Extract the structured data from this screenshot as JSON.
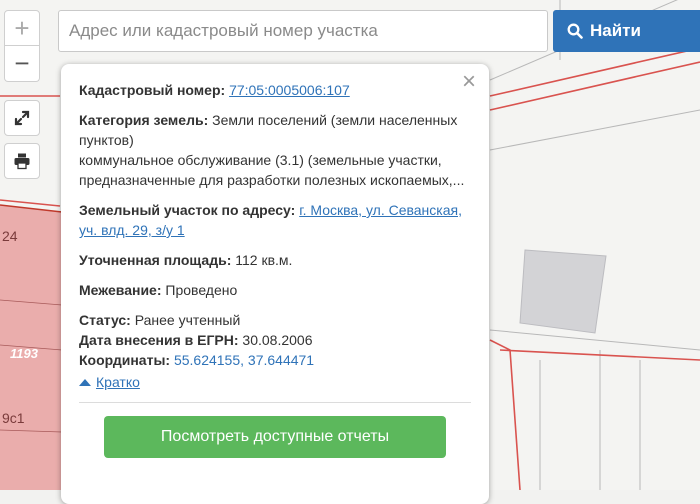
{
  "search": {
    "placeholder": "Адрес или кадастровый номер участка",
    "button_label": "Найти"
  },
  "controls": {
    "zoom_in": "+",
    "zoom_out": "−"
  },
  "map": {
    "labels": [
      "24",
      "1193",
      "9с1"
    ],
    "parcel_color": "#e8a0a0",
    "boundary_color": "#d9534f"
  },
  "popup": {
    "close_symbol": "×",
    "cadastral": {
      "label": "Кадастровый номер:",
      "value": "77:05:0005006:107"
    },
    "category": {
      "label": "Категория земель:",
      "value": "Земли поселений (земли населенных пунктов)",
      "detail": "коммунальное обслуживание (3.1) (земельные участки, предназначенные для разработки полезных ископаемых,..."
    },
    "address": {
      "label": "Земельный участок по адресу:",
      "value": "г. Москва, ул. Севанская, уч. влд. 29, з/у 1"
    },
    "area": {
      "label": "Уточненная площадь:",
      "value": "112 кв.м."
    },
    "survey": {
      "label": "Межевание:",
      "value": "Проведено"
    },
    "status": {
      "label": "Статус:",
      "value": "Ранее учтенный"
    },
    "egrn_date": {
      "label": "Дата внесения в ЕГРН:",
      "value": "30.08.2006"
    },
    "coords": {
      "label": "Координаты:",
      "value": "55.624155, 37.644471"
    },
    "collapse_label": "Кратко",
    "reports_button": "Посмотреть доступные отчеты"
  },
  "colors": {
    "accent_blue": "#2f73b8",
    "button_green": "#5cb85c"
  }
}
